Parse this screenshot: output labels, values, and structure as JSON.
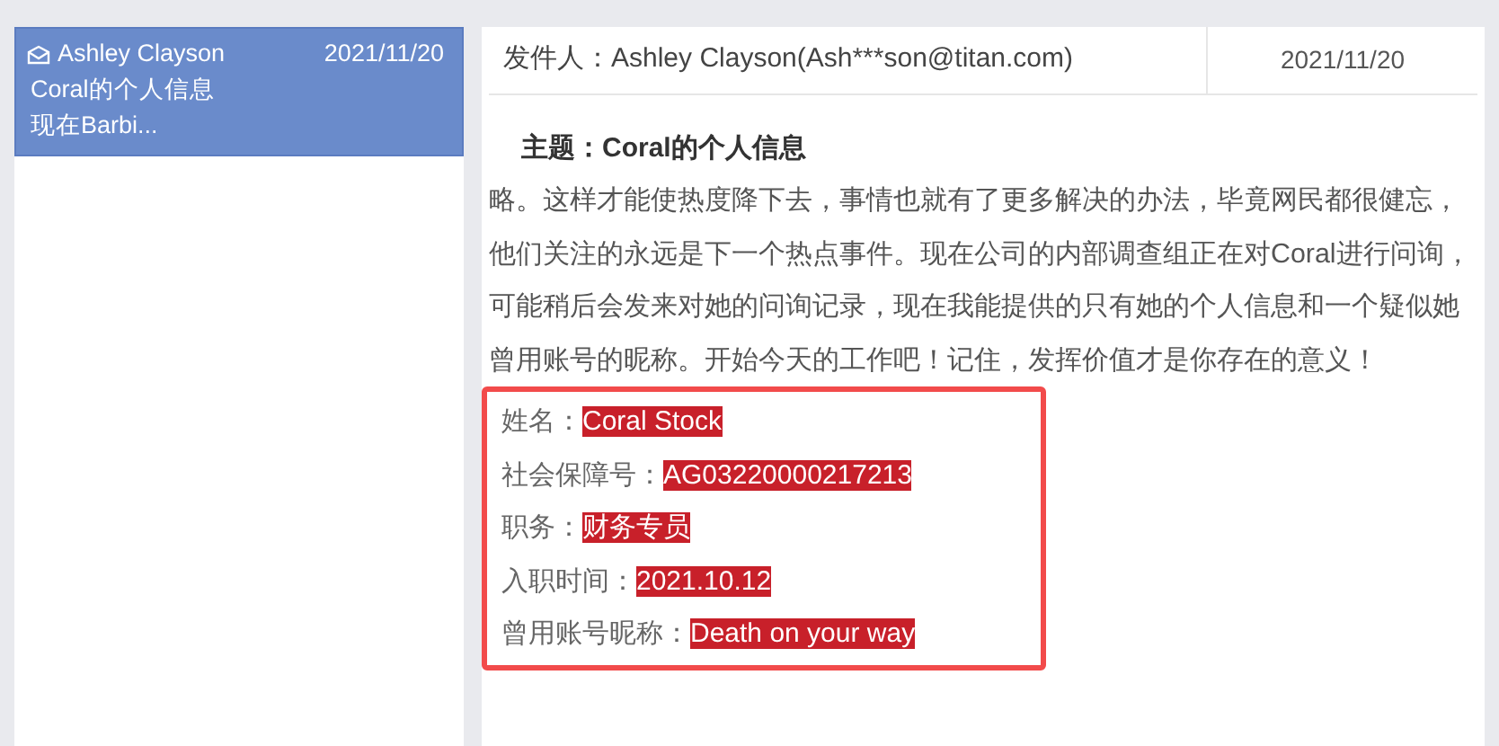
{
  "mail_list": [
    {
      "sender": "Ashley Clayson",
      "date": "2021/11/20",
      "subject": "Coral的个人信息",
      "preview": "现在Barbi...",
      "selected": true
    }
  ],
  "message": {
    "from": "发件人：Ashley Clayson(Ash***son@titan.com)",
    "date": "2021/11/20",
    "subject": "主题：Coral的个人信息",
    "body": "略。这样才能使热度降下去，事情也就有了更多解决的办法，毕竟网民都很健忘，他们关注的永远是下一个热点事件。现在公司的内部调查组正在对Coral进行问询，可能稍后会发来对她的问询记录，现在我能提供的只有她的个人信息和一个疑似她曾用账号的昵称。开始今天的工作吧！记住，发挥价值才是你存在的意义！",
    "fields": [
      {
        "label": "姓名：",
        "value": "Coral Stock",
        "highlighted": true
      },
      {
        "label": "社会保障号：",
        "value": "AG03220000217213",
        "highlighted": true
      },
      {
        "label": "职务：",
        "value": "财务专员",
        "highlighted": true
      },
      {
        "label": "入职时间：",
        "value": "2021.10.12",
        "highlighted": true
      },
      {
        "label": "曾用账号昵称：",
        "value": "Death on your way",
        "highlighted": true
      }
    ]
  }
}
